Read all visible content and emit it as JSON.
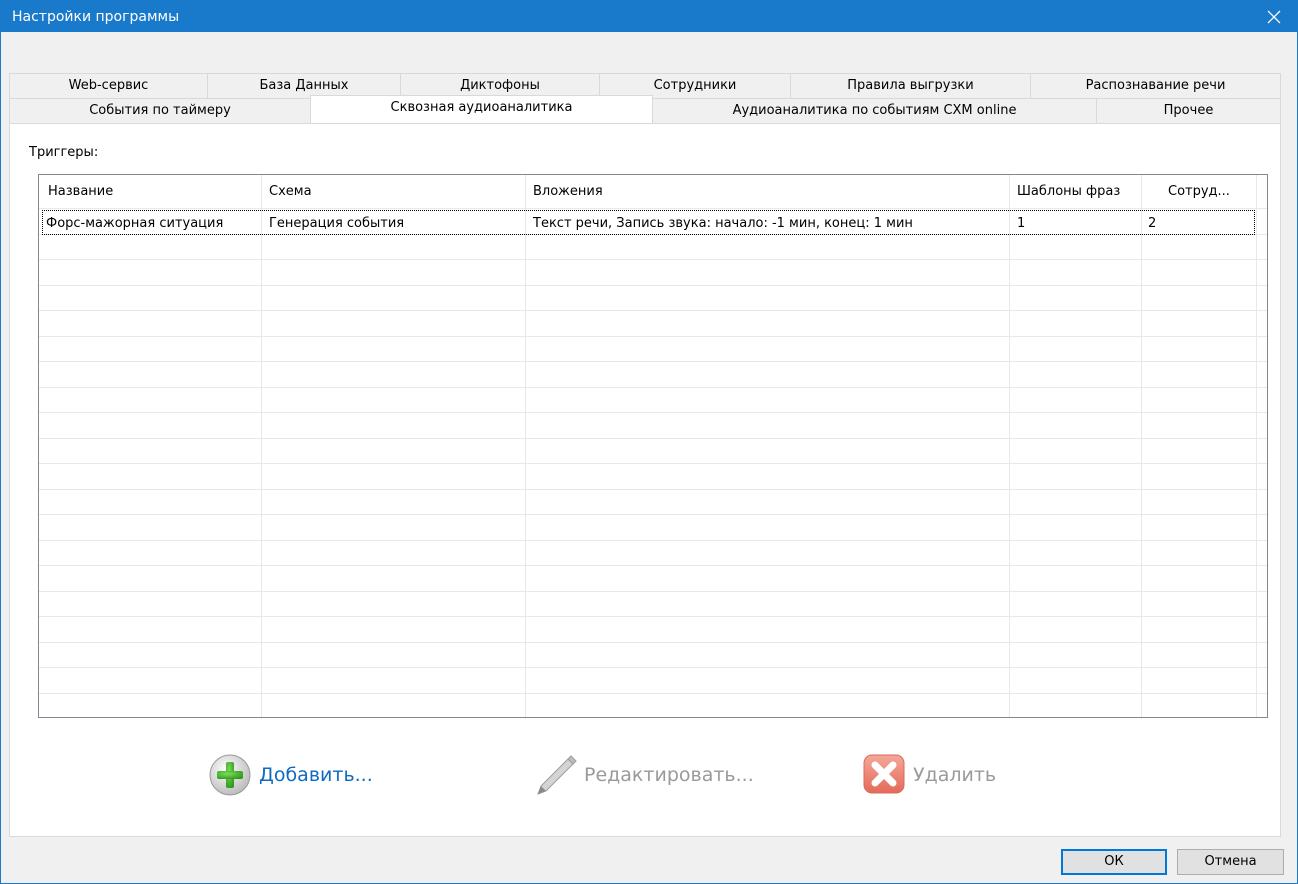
{
  "window": {
    "title": "Настройки программы"
  },
  "tabs": {
    "row1": [
      "Web-сервис",
      "База Данных",
      "Диктофоны",
      "Сотрудники",
      "Правила выгрузки",
      "Распознавание речи"
    ],
    "row2": [
      "События по таймеру",
      "Сквозная аудиоаналитика",
      "Аудиоаналитика по событиям CXM online",
      "Прочее"
    ],
    "active": "Сквозная аудиоаналитика"
  },
  "triggers": {
    "label": "Триггеры:",
    "columns": [
      "Название",
      "Схема",
      "Вложения",
      "Шаблоны фраз",
      "Сотруд..."
    ],
    "rows": [
      [
        "Форс-мажорная ситуация",
        "Генерация события",
        "Текст речи, Запись звука: начало: -1 мин, конец: 1 мин",
        "1",
        "2"
      ]
    ]
  },
  "actions": {
    "add": "Добавить...",
    "edit": "Редактировать...",
    "delete": "Удалить"
  },
  "buttons": {
    "ok": "ОК",
    "cancel": "Отмена"
  },
  "colors": {
    "titlebar": "#1979ca",
    "link": "#0f6bc1",
    "disabled": "#9a9a9a"
  },
  "icons": {
    "close": "close-icon",
    "add": "plus-circle-icon",
    "edit": "pen-icon",
    "delete": "x-square-icon"
  }
}
